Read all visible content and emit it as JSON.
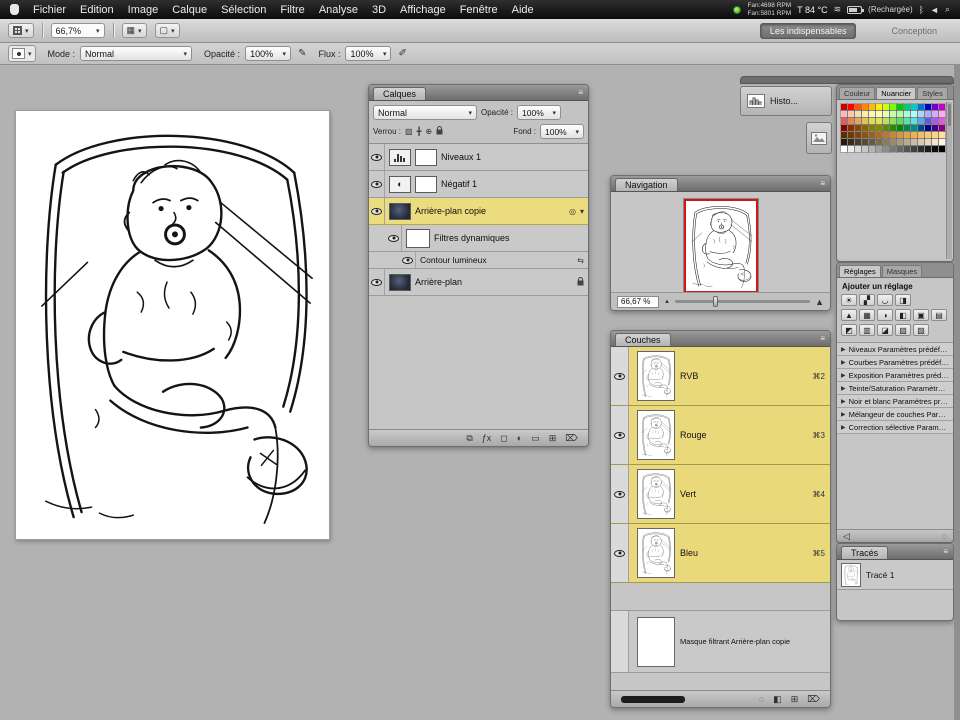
{
  "menubar": {
    "items": [
      "Fichier",
      "Edition",
      "Image",
      "Calque",
      "Sélection",
      "Filtre",
      "Analyse",
      "3D",
      "Affichage",
      "Fenêtre",
      "Aide"
    ],
    "status": {
      "fan1": "Fan:4698 RPM",
      "fan2": "Fan:5801 RPM",
      "temp": "T 84 °C",
      "charge_text": "(Rechargée)"
    }
  },
  "optionsbar": {
    "zoom_value": "66,7%",
    "workspace_active": "Les indispensables",
    "workspace_next": "Conception"
  },
  "brushbar": {
    "mode_label": "Mode :",
    "mode_value": "Normal",
    "opacity_label": "Opacité :",
    "opacity_value": "100%",
    "flow_label": "Flux :",
    "flow_value": "100%"
  },
  "layers": {
    "title": "Calques",
    "blend_mode": "Normal",
    "opacity_label": "Opacité :",
    "opacity_value": "100%",
    "lock_label": "Verrou :",
    "fill_label": "Fond :",
    "fill_value": "100%",
    "items": [
      {
        "name": "Niveaux 1",
        "type": "adjustment-levels"
      },
      {
        "name": "Négatif 1",
        "type": "adjustment-invert"
      },
      {
        "name": "Arrière-plan copie",
        "type": "image",
        "selected": true
      },
      {
        "name": "Filtres dynamiques",
        "type": "smart-filters"
      },
      {
        "name": "Contour lumineux",
        "type": "filter"
      },
      {
        "name": "Arrière-plan",
        "type": "background",
        "locked": true
      }
    ],
    "bottom_icons": [
      "link-layers-icon",
      "layer-effects-icon",
      "add-layer-mask-icon",
      "new-adjustment-layer-icon",
      "new-group-icon",
      "new-layer-icon",
      "delete-layer-icon"
    ]
  },
  "navigator": {
    "title": "Navigation",
    "zoom_value": "66,67 %"
  },
  "channels": {
    "title": "Couches",
    "items": [
      {
        "name": "RVB",
        "shortcut": "⌘2"
      },
      {
        "name": "Rouge",
        "shortcut": "⌘3"
      },
      {
        "name": "Vert",
        "shortcut": "⌘4"
      },
      {
        "name": "Bleu",
        "shortcut": "⌘5"
      },
      {
        "name": "Masque filtrant Arrière-plan copie",
        "shortcut": ""
      }
    ],
    "bottom_icons": [
      "load-channel-selection-icon",
      "save-selection-as-channel-icon",
      "new-channel-icon",
      "delete-channel-icon"
    ]
  },
  "collapsed_panels": {
    "histogram_label": "Histo..."
  },
  "swatches": {
    "tabs": [
      "Couleur",
      "Nuancier",
      "Styles"
    ],
    "active_tab": "Nuancier",
    "colors": [
      "#cc0000",
      "#ff0000",
      "#ff5500",
      "#ff8800",
      "#ffbb00",
      "#ffee00",
      "#ccff00",
      "#77ff00",
      "#00cc00",
      "#00cc77",
      "#00cccc",
      "#0077cc",
      "#0000cc",
      "#7700cc",
      "#cc00cc",
      "#ffb7b7",
      "#ffc9a9",
      "#ffdba9",
      "#ffeca9",
      "#fff8a9",
      "#ffffb7",
      "#e6ffa9",
      "#c4ffa9",
      "#a9ffa9",
      "#a9ffd6",
      "#a9ffff",
      "#a9d6ff",
      "#a9adff",
      "#d2a9ff",
      "#ffa9ff",
      "#e05c5c",
      "#e0855c",
      "#e0a85c",
      "#e0c25c",
      "#e0d65c",
      "#dfe05c",
      "#bce05c",
      "#8ce05c",
      "#5ce05c",
      "#5ce0a8",
      "#5ce0e0",
      "#5ca8e0",
      "#5c5ee0",
      "#a85ce0",
      "#e05cd6",
      "#8a0000",
      "#8a2e00",
      "#8a4a00",
      "#8a6200",
      "#8a7a00",
      "#868a00",
      "#5c8a00",
      "#2e8a00",
      "#008a00",
      "#008a4a",
      "#008a8a",
      "#004a8a",
      "#00068a",
      "#4a008a",
      "#8a008a",
      "#5c2e00",
      "#6b3a08",
      "#7a4710",
      "#895418",
      "#986120",
      "#a76e28",
      "#b67b30",
      "#c58838",
      "#d49540",
      "#e3a248",
      "#f2af50",
      "#f8bc60",
      "#fcc970",
      "#fed680",
      "#ffe390",
      "#2a1a0a",
      "#3a2a18",
      "#4a3a26",
      "#5a4a34",
      "#6a5a42",
      "#7a6a50",
      "#8a7a5e",
      "#9a8a6c",
      "#aa9a7a",
      "#baaa88",
      "#cabaa6",
      "#dacab4",
      "#e8d8c2",
      "#f2e6d0",
      "#fcf4de",
      "#ffffff",
      "#ececec",
      "#d9d9d9",
      "#c6c6c6",
      "#b3b3b3",
      "#a0a0a0",
      "#8d8d8d",
      "#7a7a7a",
      "#676767",
      "#545454",
      "#414141",
      "#2e2e2e",
      "#1b1b1b",
      "#0d0d0d",
      "#000000"
    ]
  },
  "adjustments": {
    "tab_active": "Réglages",
    "tab_other": "Masques",
    "heading": "Ajouter un réglage",
    "icon_rows": [
      [
        "brightness-contrast",
        "levels",
        "curves",
        "exposure"
      ],
      [
        "vibrance",
        "hue-saturation",
        "color-balance",
        "black-white",
        "photo-filter",
        "channel-mixer"
      ],
      [
        "invert",
        "posterize",
        "threshold",
        "gradient-map",
        "selective-color"
      ]
    ],
    "presets": [
      "Niveaux Paramètres prédéfinis",
      "Courbes Paramètres prédéfinis",
      "Exposition Paramètres prédéfinis",
      "Teinte/Saturation Paramètres prédéfinis",
      "Noir et blanc Paramètres prédéfinis",
      "Mélangeur de couches Paramètres prédéfinis",
      "Correction sélective Paramètres prédéfinis"
    ]
  },
  "paths": {
    "title": "Tracés",
    "items": [
      {
        "name": "Tracé 1"
      }
    ]
  }
}
